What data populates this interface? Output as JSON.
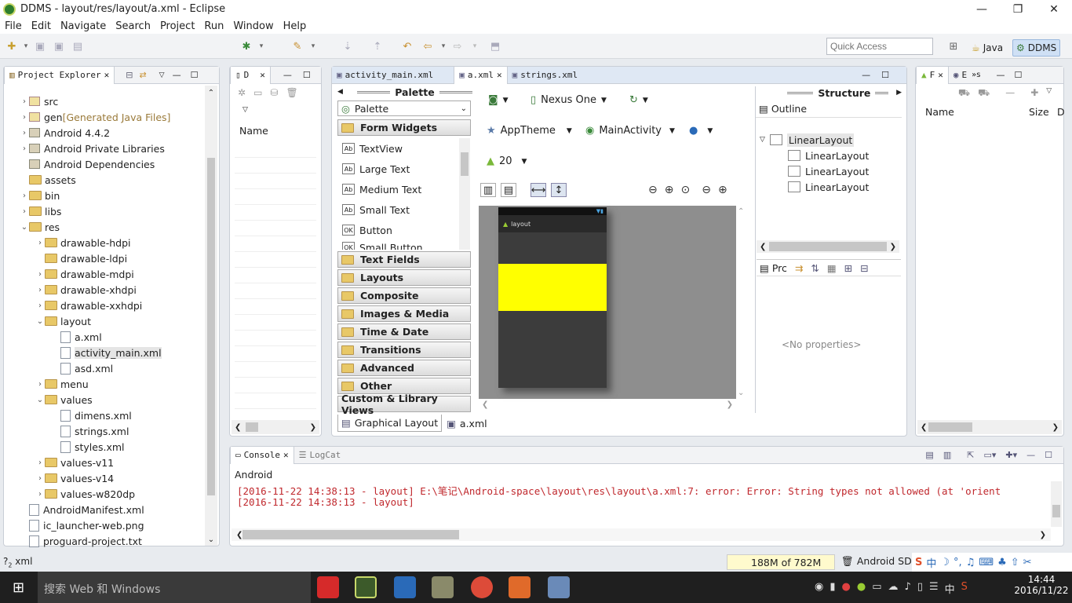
{
  "window": {
    "title": "DDMS - layout/res/layout/a.xml - Eclipse",
    "minimize": "—",
    "restore": "❐",
    "close": "✕"
  },
  "menu": [
    "File",
    "Edit",
    "Navigate",
    "Search",
    "Project",
    "Run",
    "Window",
    "Help"
  ],
  "quick_access": {
    "placeholder": "Quick Access"
  },
  "perspectives": [
    {
      "label": "Java",
      "icon": "java-perspective-icon"
    },
    {
      "label": "DDMS",
      "icon": "ddms-perspective-icon",
      "active": true
    }
  ],
  "project_explorer": {
    "tab": "Project Explorer",
    "items": [
      {
        "label": "src",
        "arrow": ">",
        "icon": "package",
        "level": 1
      },
      {
        "label": "gen",
        "suffix": "[Generated Java Files]",
        "arrow": ">",
        "icon": "package",
        "level": 1
      },
      {
        "label": "Android 4.4.2",
        "arrow": ">",
        "icon": "library",
        "level": 1
      },
      {
        "label": "Android Private Libraries",
        "arrow": ">",
        "icon": "library",
        "level": 1
      },
      {
        "label": "Android Dependencies",
        "arrow": "",
        "icon": "library",
        "level": 1
      },
      {
        "label": "assets",
        "arrow": "",
        "icon": "folder",
        "level": 1
      },
      {
        "label": "bin",
        "arrow": ">",
        "icon": "folder",
        "level": 1
      },
      {
        "label": "libs",
        "arrow": ">",
        "icon": "folder",
        "level": 1
      },
      {
        "label": "res",
        "arrow": "v",
        "icon": "folder",
        "level": 1
      },
      {
        "label": "drawable-hdpi",
        "arrow": ">",
        "icon": "folder",
        "level": 2
      },
      {
        "label": "drawable-ldpi",
        "arrow": "",
        "icon": "folder",
        "level": 2
      },
      {
        "label": "drawable-mdpi",
        "arrow": ">",
        "icon": "folder",
        "level": 2
      },
      {
        "label": "drawable-xhdpi",
        "arrow": ">",
        "icon": "folder",
        "level": 2
      },
      {
        "label": "drawable-xxhdpi",
        "arrow": ">",
        "icon": "folder",
        "level": 2
      },
      {
        "label": "layout",
        "arrow": "v",
        "icon": "folder",
        "level": 2
      },
      {
        "label": "a.xml",
        "arrow": "",
        "icon": "file",
        "level": 3
      },
      {
        "label": "activity_main.xml",
        "arrow": "",
        "icon": "file",
        "level": 3,
        "selected": true
      },
      {
        "label": "asd.xml",
        "arrow": "",
        "icon": "file",
        "level": 3
      },
      {
        "label": "menu",
        "arrow": ">",
        "icon": "folder",
        "level": 2
      },
      {
        "label": "values",
        "arrow": "v",
        "icon": "folder",
        "level": 2
      },
      {
        "label": "dimens.xml",
        "arrow": "",
        "icon": "file",
        "level": 3
      },
      {
        "label": "strings.xml",
        "arrow": "",
        "icon": "file",
        "level": 3
      },
      {
        "label": "styles.xml",
        "arrow": "",
        "icon": "file",
        "level": 3
      },
      {
        "label": "values-v11",
        "arrow": ">",
        "icon": "folder",
        "level": 2
      },
      {
        "label": "values-v14",
        "arrow": ">",
        "icon": "folder",
        "level": 2
      },
      {
        "label": "values-w820dp",
        "arrow": ">",
        "icon": "folder",
        "level": 2
      },
      {
        "label": "AndroidManifest.xml",
        "arrow": "",
        "icon": "file",
        "level": 1
      },
      {
        "label": "ic_launcher-web.png",
        "arrow": "",
        "icon": "file",
        "level": 1
      },
      {
        "label": "proguard-project.txt",
        "arrow": "",
        "icon": "file",
        "level": 1
      }
    ]
  },
  "devices_view": {
    "tab": "D",
    "column": "Name"
  },
  "editor": {
    "tabs": [
      {
        "label": "activity_main.xml"
      },
      {
        "label": "a.xml",
        "active": true
      },
      {
        "label": "strings.xml"
      }
    ],
    "palette": {
      "title": "Palette",
      "dropdown": "Palette",
      "categories_open": "Form Widgets",
      "widgets": [
        {
          "label": "TextView",
          "icon": "Ab"
        },
        {
          "label": "Large Text",
          "icon": "Ab"
        },
        {
          "label": "Medium Text",
          "icon": "Ab"
        },
        {
          "label": "Small Text",
          "icon": "Ab"
        },
        {
          "label": "Button",
          "icon": "OK"
        },
        {
          "label": "Small Button",
          "icon": "OK"
        }
      ],
      "categories": [
        "Text Fields",
        "Layouts",
        "Composite",
        "Images & Media",
        "Time & Date",
        "Transitions",
        "Advanced",
        "Other"
      ],
      "custom": "Custom & Library Views"
    },
    "canvas_toolbar": {
      "device": "Nexus One",
      "theme": "AppTheme",
      "activity": "MainActivity",
      "api": "20"
    },
    "preview": {
      "app_title": "layout",
      "highlight_color": "#ffff00"
    },
    "bottom_tabs": [
      {
        "label": "Graphical Layout",
        "active": true
      },
      {
        "label": "a.xml"
      }
    ]
  },
  "structure": {
    "title": "Structure",
    "outline_label": "Outline",
    "tree": [
      {
        "label": "LinearLayout",
        "root": true
      },
      {
        "label": "LinearLayout"
      },
      {
        "label": "LinearLayout"
      },
      {
        "label": "LinearLayout"
      }
    ],
    "properties_tab": "Prc",
    "no_properties": "<No properties>"
  },
  "file_explorer": {
    "tab1": "F",
    "tab2": "E",
    "tab3": "»s",
    "col_name": "Name",
    "col_size": "Size",
    "col_d": "D"
  },
  "console": {
    "tabs": [
      {
        "label": "Console",
        "active": true
      },
      {
        "label": "LogCat"
      }
    ],
    "source": "Android",
    "lines": [
      "[2016-11-22 14:38:13 - layout] E:\\笔记\\Android-space\\layout\\res\\layout\\a.xml:7: error: Error: String types not allowed (at 'orient",
      "[2016-11-22 14:38:13 - layout]"
    ]
  },
  "statusbar": {
    "left": "xml",
    "memory": "188M of 782M",
    "sdk": "Android SDK"
  },
  "taskbar": {
    "search": "搜索 Web 和 Windows",
    "time": "14:44",
    "date": "2016/11/22",
    "ime": "中"
  }
}
